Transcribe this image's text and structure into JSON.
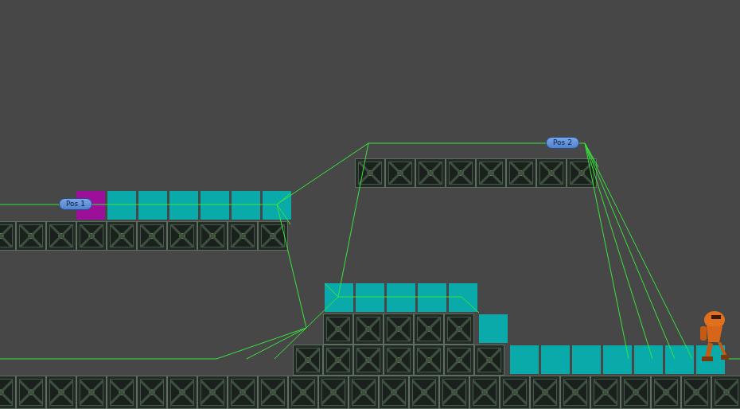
{
  "scene": {
    "waypoints": [
      {
        "label": "Pos 1"
      },
      {
        "label": "Pos 2"
      }
    ],
    "marker_rows": [
      {
        "markers": [
          {
            "selected": true
          },
          {
            "selected": false
          },
          {
            "selected": false
          },
          {
            "selected": false
          },
          {
            "selected": false
          },
          {
            "selected": false
          },
          {
            "selected": false
          }
        ]
      },
      {
        "markers": [
          {
            "selected": false
          },
          {
            "selected": false
          },
          {
            "selected": false
          },
          {
            "selected": false
          },
          {
            "selected": false
          }
        ]
      },
      {
        "markers": [
          {
            "selected": false
          }
        ]
      },
      {
        "markers": [
          {
            "selected": false
          },
          {
            "selected": false
          },
          {
            "selected": false
          },
          {
            "selected": false
          },
          {
            "selected": false
          },
          {
            "selected": false
          },
          {
            "selected": false
          }
        ]
      }
    ]
  }
}
